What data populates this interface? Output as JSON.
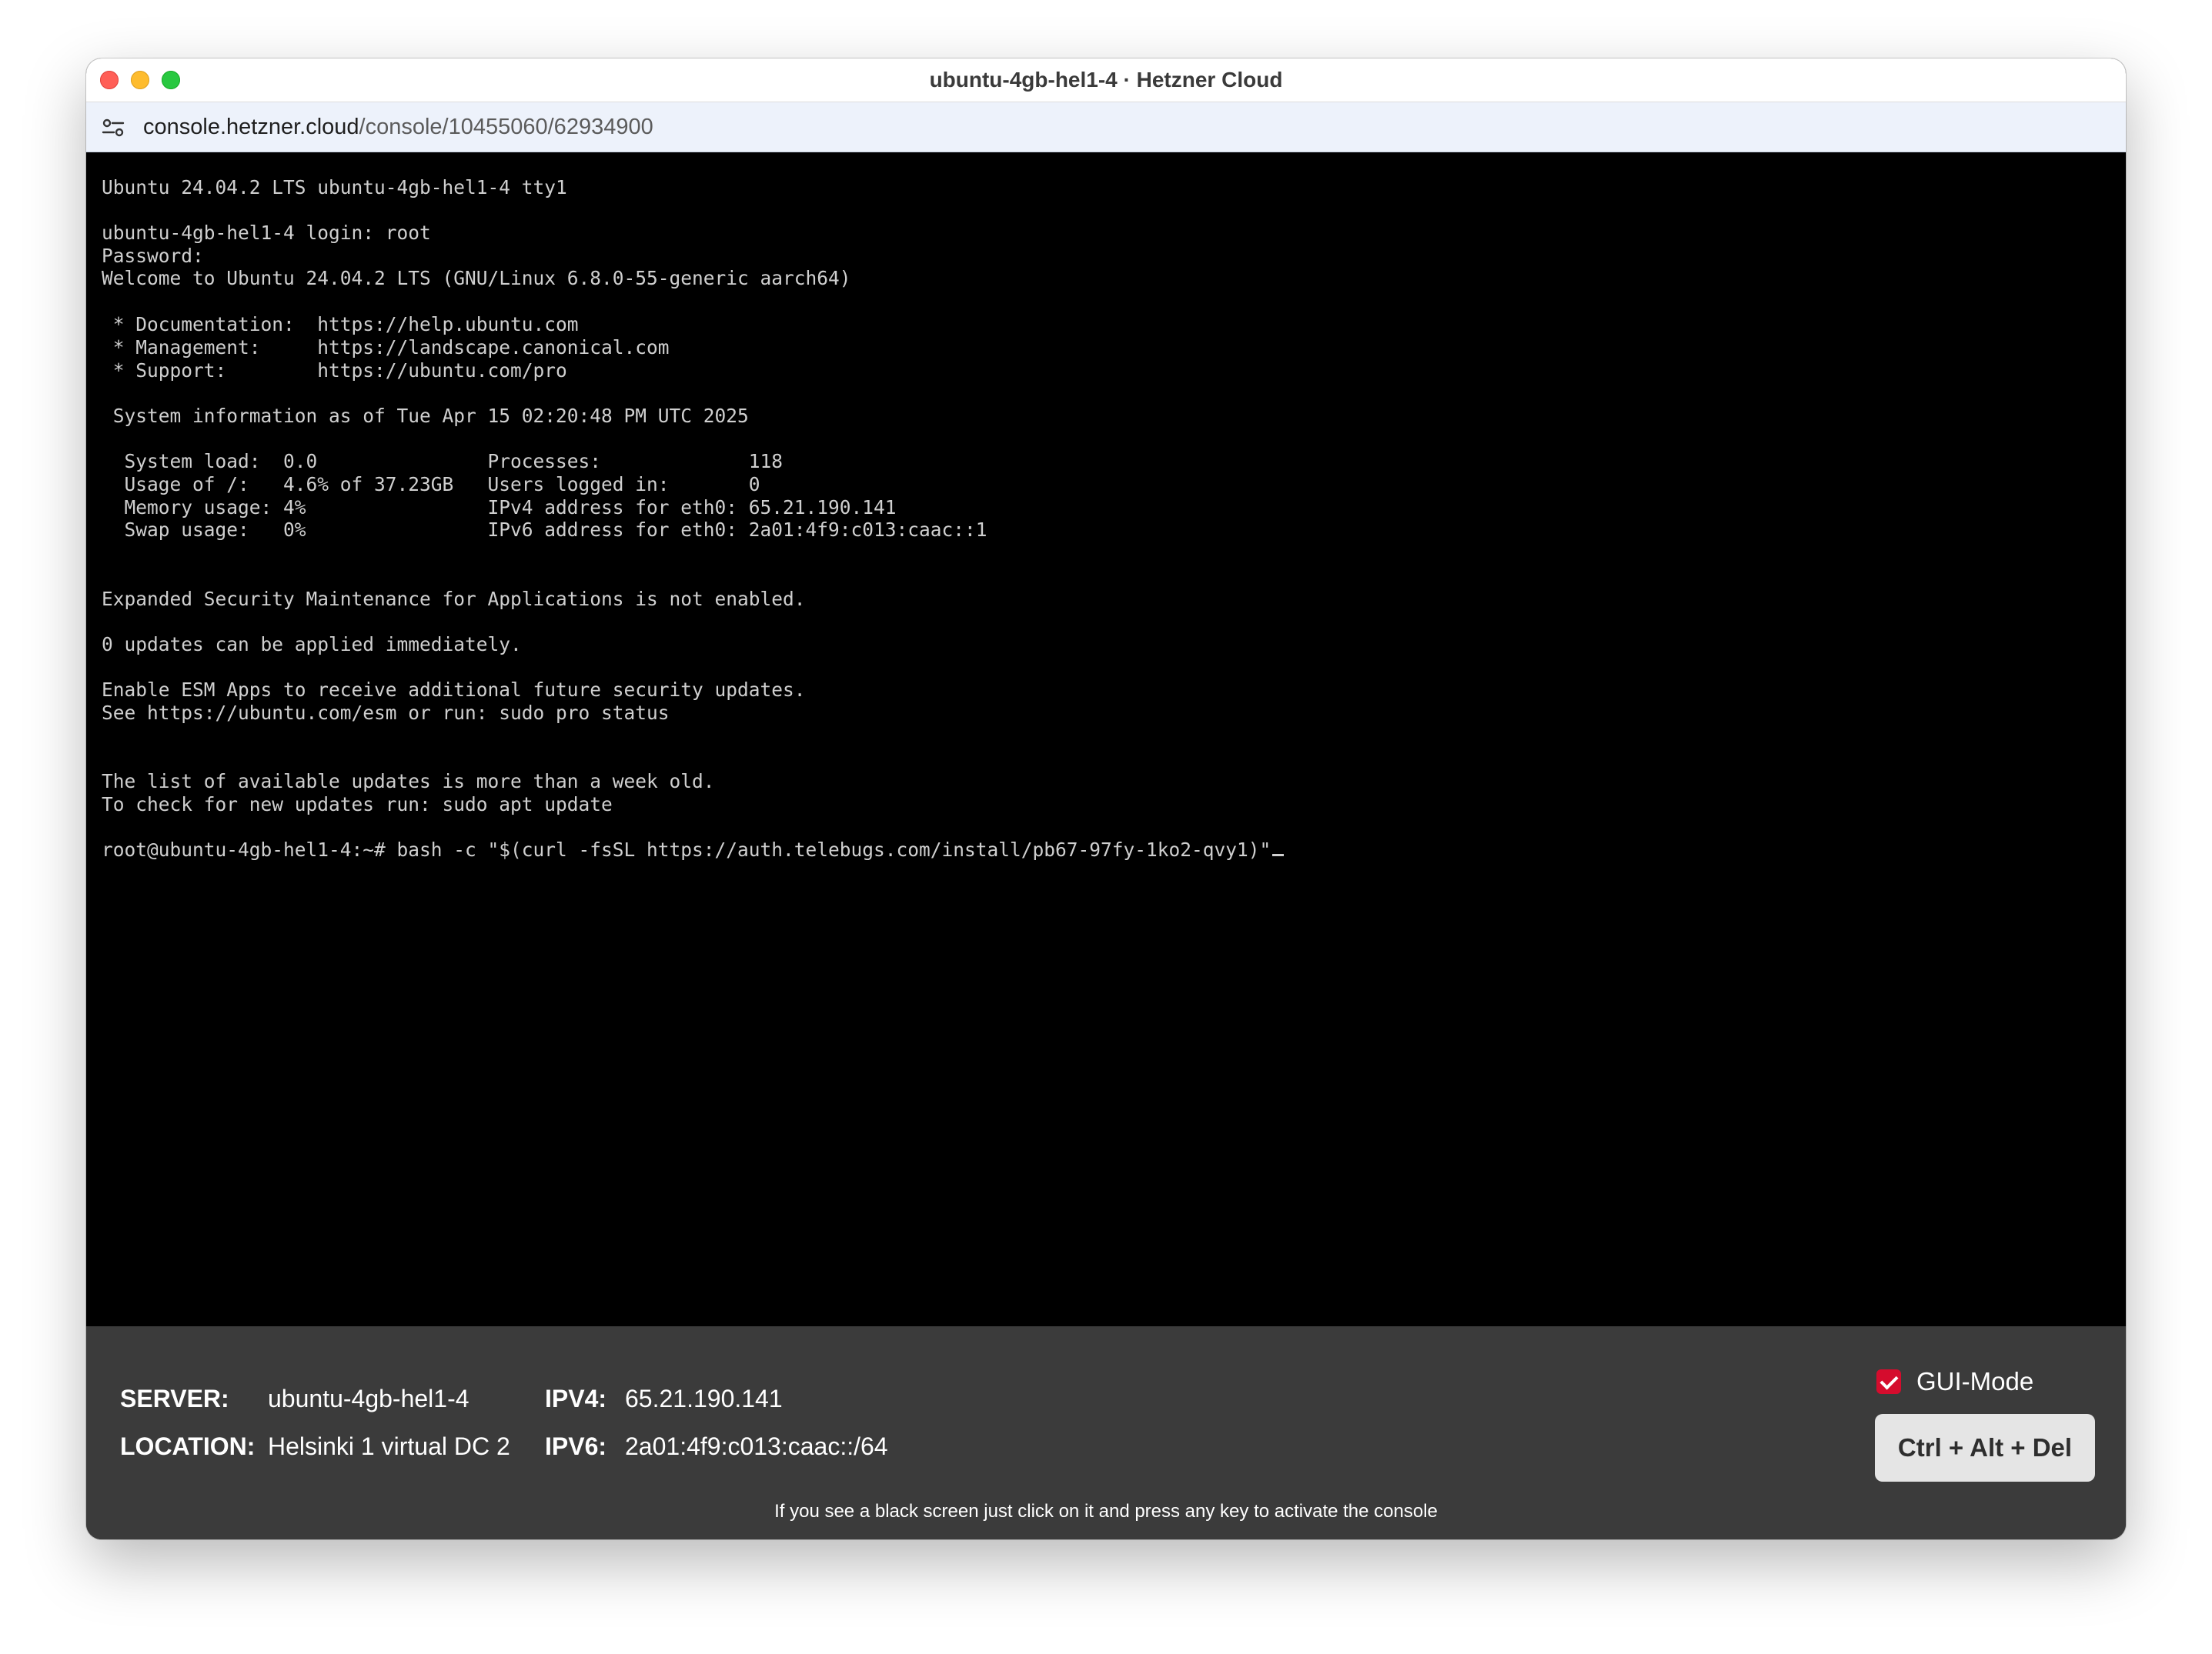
{
  "window": {
    "title": "ubuntu-4gb-hel1-4 · Hetzner Cloud"
  },
  "address_bar": {
    "url_host": "console.hetzner.cloud",
    "url_path": "/console/10455060/62934900",
    "icon": "site-settings-icon"
  },
  "terminal": {
    "lines": [
      "Ubuntu 24.04.2 LTS ubuntu-4gb-hel1-4 tty1",
      "",
      "ubuntu-4gb-hel1-4 login: root",
      "Password:",
      "Welcome to Ubuntu 24.04.2 LTS (GNU/Linux 6.8.0-55-generic aarch64)",
      "",
      " * Documentation:  https://help.ubuntu.com",
      " * Management:     https://landscape.canonical.com",
      " * Support:        https://ubuntu.com/pro",
      "",
      " System information as of Tue Apr 15 02:20:48 PM UTC 2025",
      "",
      "  System load:  0.0               Processes:             118",
      "  Usage of /:   4.6% of 37.23GB   Users logged in:       0",
      "  Memory usage: 4%                IPv4 address for eth0: 65.21.190.141",
      "  Swap usage:   0%                IPv6 address for eth0: 2a01:4f9:c013:caac::1",
      "",
      "",
      "Expanded Security Maintenance for Applications is not enabled.",
      "",
      "0 updates can be applied immediately.",
      "",
      "Enable ESM Apps to receive additional future security updates.",
      "See https://ubuntu.com/esm or run: sudo pro status",
      "",
      "",
      "The list of available updates is more than a week old.",
      "To check for new updates run: sudo apt update",
      "",
      "root@ubuntu-4gb-hel1-4:~# bash -c \"$(curl -fsSL https://auth.telebugs.com/install/pb67-97fy-1ko2-qvy1)\""
    ]
  },
  "info": {
    "server_label": "SERVER:",
    "server_value": "ubuntu-4gb-hel1-4",
    "location_label": "LOCATION:",
    "location_value": "Helsinki 1 virtual DC 2",
    "ipv4_label": "IPV4:",
    "ipv4_value": "65.21.190.141",
    "ipv6_label": "IPV6:",
    "ipv6_value": "2a01:4f9:c013:caac::/64",
    "gui_mode_label": "GUI-Mode",
    "gui_mode_checked": true,
    "ctrl_alt_del_label": "Ctrl + Alt + Del",
    "hint": "If you see a black screen just click on it and press any key to activate the console"
  },
  "colors": {
    "terminal_bg": "#000000",
    "terminal_fg": "#cfcfcf",
    "infobar_bg": "#3b3b3b",
    "checkbox_accent": "#d50c2d"
  }
}
